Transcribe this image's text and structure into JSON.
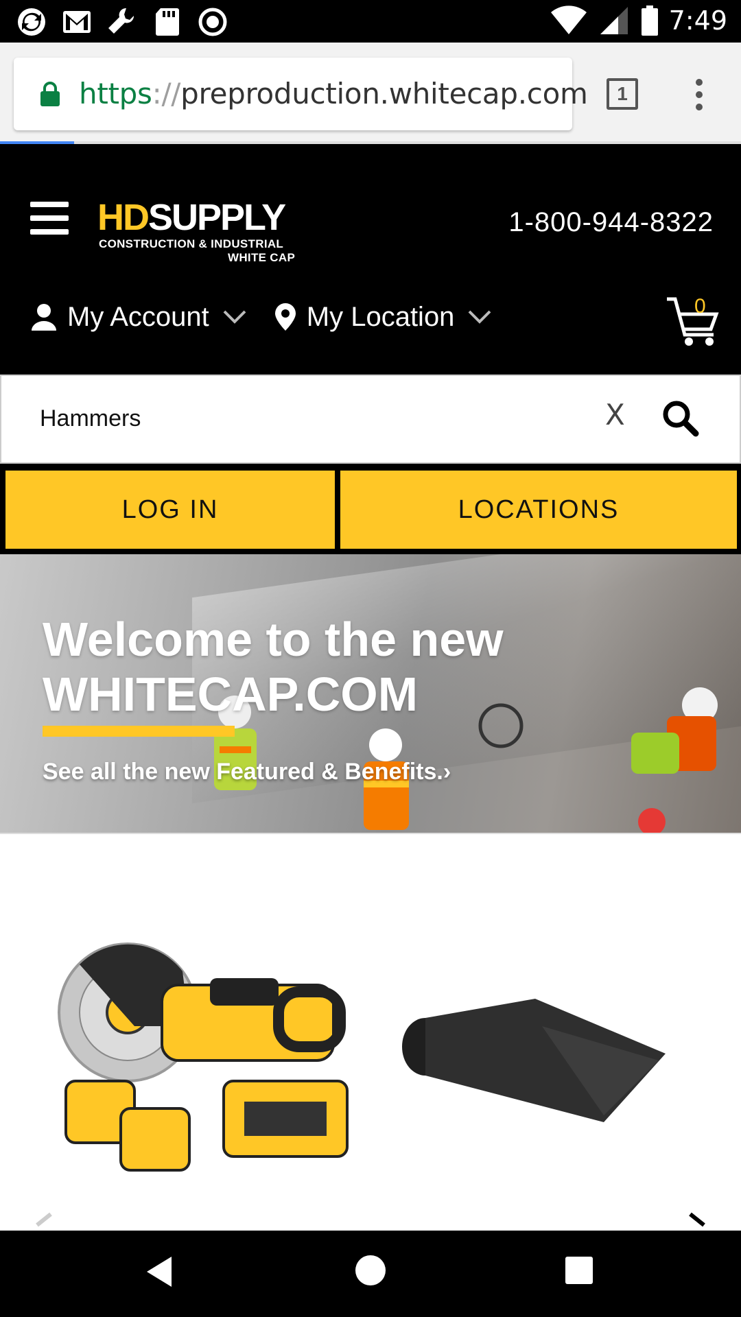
{
  "status_bar": {
    "time": "7:49",
    "icons": [
      "sync-icon",
      "gmail-icon",
      "wrench-icon",
      "sd-card-icon",
      "record-icon",
      "wifi-icon",
      "signal-icon",
      "battery-icon"
    ]
  },
  "browser": {
    "url_scheme": "https",
    "url_separator": "://",
    "url_host": "preproduction.whitecap.com",
    "tab_count": "1",
    "load_progress_fraction": 0.1
  },
  "header": {
    "logo_hd": "HD",
    "logo_supply": "SUPPLY",
    "logo_line1": "CONSTRUCTION & INDUSTRIAL",
    "logo_line2": "WHITE CAP",
    "phone": "1-800-944-8322",
    "nav": {
      "account_label": "My Account",
      "location_label": "My Location"
    },
    "cart_count": "0"
  },
  "search": {
    "value": "Hammers",
    "clear_label": "X"
  },
  "buttons": {
    "login": "LOG IN",
    "locations": "LOCATIONS"
  },
  "banner": {
    "title_line1": "Welcome to the new",
    "title_line2": "WHITECAP.COM",
    "link_text": "See all the new Featured & Benefits.",
    "link_arrow": "›"
  },
  "colors": {
    "brand_yellow": "#ffc726",
    "header_bg": "#000000",
    "url_secure_green": "#0b8043"
  }
}
